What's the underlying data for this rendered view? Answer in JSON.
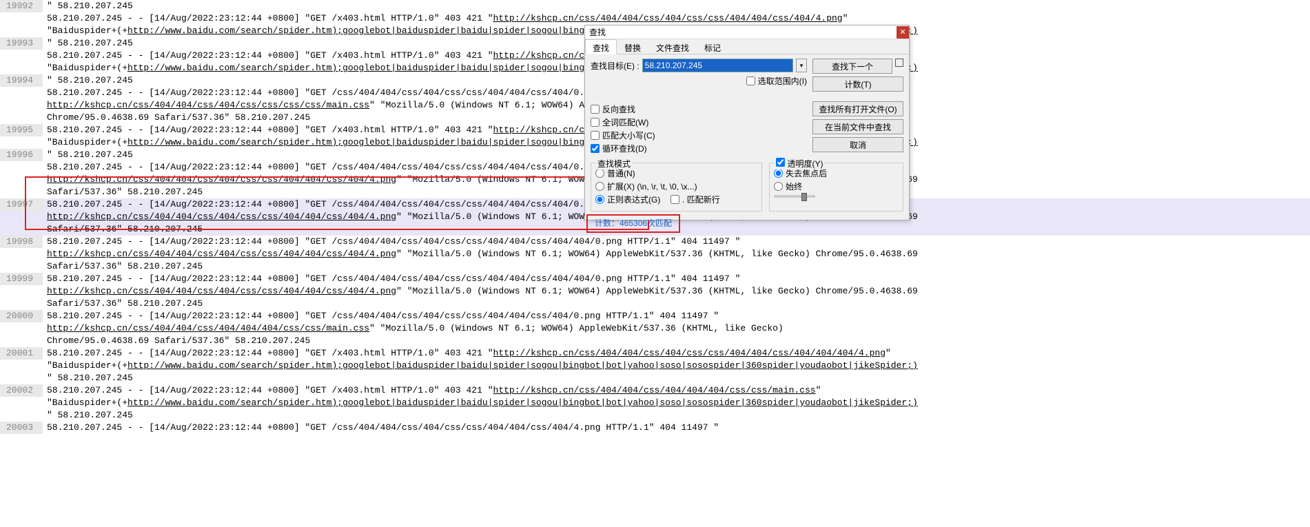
{
  "lines": [
    {
      "num": "19992",
      "hl": false,
      "segs": [
        {
          "t": "\" 58.210.207.245"
        }
      ]
    },
    {
      "num": "",
      "hl": false,
      "segs": [
        {
          "t": "58.210.207.245 - - [14/Aug/2022:23:12:44 +0800] \"GET /x403.html HTTP/1.0\" 403 421 \""
        },
        {
          "t": "http://kshcp.cn/css/404/404/css/404/css/css/404/404/css/404/4.png",
          "u": true
        },
        {
          "t": "\""
        }
      ]
    },
    {
      "num": "",
      "hl": false,
      "segs": [
        {
          "t": "\"Baiduspider+(+"
        },
        {
          "t": "http://www.baidu.com/search/spider.htm);googlebot|baiduspider|baidu|spider|sogou|bingbot|bot|yahoo|soso|sosospider|360spider|youdaobot|jikeSpider;)",
          "u": true
        }
      ]
    },
    {
      "num": "19993",
      "hl": false,
      "segs": [
        {
          "t": "\" 58.210.207.245"
        }
      ]
    },
    {
      "num": "",
      "hl": false,
      "segs": [
        {
          "t": "58.210.207.245 - - [14/Aug/2022:23:12:44 +0800] \"GET /x403.html HTTP/1.0\" 403 421 \""
        },
        {
          "t": "http://kshcp.cn/css/404/404/css/404/css/css/404/404/css/404/4.png",
          "u": true
        },
        {
          "t": "\""
        }
      ]
    },
    {
      "num": "",
      "hl": false,
      "segs": [
        {
          "t": "\"Baiduspider+(+"
        },
        {
          "t": "http://www.baidu.com/search/spider.htm);googlebot|baiduspider|baidu|spider|sogou|bingbot|bot|yahoo|soso|sosospider|360spider|youdaobot|jikeSpider;)",
          "u": true
        }
      ]
    },
    {
      "num": "19994",
      "hl": false,
      "segs": [
        {
          "t": "\" 58.210.207.245"
        }
      ]
    },
    {
      "num": "",
      "hl": false,
      "segs": [
        {
          "t": "58.210.207.245 - - [14/Aug/2022:23:12:44 +0800] \"GET /css/404/404/css/404/css/css/404/404/css/404/0.png HTTP/1.1\" 404 11497 \""
        }
      ]
    },
    {
      "num": "",
      "hl": false,
      "segs": [
        {
          "t": "http://kshcp.cn/css/404/404/css/404/css/css/css/css/main.css",
          "u": true
        },
        {
          "t": "\" \"Mozilla/5.0 (Windows NT 6.1; WOW64) AppleWebKit/537.36 (KHTML, like Gecko)"
        }
      ]
    },
    {
      "num": "",
      "hl": false,
      "segs": [
        {
          "t": "Chrome/95.0.4638.69 Safari/537.36\" 58.210.207.245"
        }
      ]
    },
    {
      "num": "19995",
      "hl": false,
      "segs": [
        {
          "t": "58.210.207.245 - - [14/Aug/2022:23:12:44 +0800] \"GET /x403.html HTTP/1.0\" 403 421 \""
        },
        {
          "t": "http://kshcp.cn/css/404/404/css/404/css/css/css/css/main.css",
          "u": true
        },
        {
          "t": "\""
        }
      ]
    },
    {
      "num": "",
      "hl": false,
      "segs": [
        {
          "t": "\"Baiduspider+(+"
        },
        {
          "t": "http://www.baidu.com/search/spider.htm);googlebot|baiduspider|baidu|spider|sogou|bingbot|bot|yahoo|soso|sosospider|360spider|youdaobot|jikeSpider;)",
          "u": true
        }
      ]
    },
    {
      "num": "19996",
      "hl": false,
      "segs": [
        {
          "t": "\" 58.210.207.245"
        }
      ]
    },
    {
      "num": "",
      "hl": false,
      "segs": [
        {
          "t": "58.210.207.245 - - [14/Aug/2022:23:12:44 +0800] \"GET /css/404/404/css/404/css/css/404/404/css/404/0.png HTTP/1.1\" 404 11497 \""
        }
      ]
    },
    {
      "num": "",
      "hl": false,
      "segs": [
        {
          "t": "http://kshcp.cn/css/404/404/css/404/css/css/404/404/css/404/4.png",
          "u": true
        },
        {
          "t": "\" \"Mozilla/5.0 (Windows NT 6.1; WOW64) AppleWebKit/537.36 (KHTML, like Gecko) Chrome/95.0.4638.69"
        }
      ]
    },
    {
      "num": "",
      "hl": false,
      "segs": [
        {
          "t": "Safari/537.36\" 58.210.207.245"
        }
      ]
    },
    {
      "num": "19997",
      "hl": true,
      "segs": [
        {
          "t": "58.210.207.245 - - [14/Aug/2022:23:12:44 +0800] \"GET /css/404/404/css/404/css/css/404/404/css/404/0.png HTTP/1.1\" 404 11497 \""
        }
      ]
    },
    {
      "num": "",
      "hl": true,
      "segs": [
        {
          "t": "http://kshcp.cn/css/404/404/css/404/css/css/404/404/css/404/4.png",
          "u": true
        },
        {
          "t": "\" \"Mozilla/5.0 (Windows NT 6.1; WOW64) AppleWebKit/537.36 (KHTML, like Gecko) Chrome/95.0.4638.69"
        }
      ]
    },
    {
      "num": "",
      "hl": true,
      "segs": [
        {
          "t": "Safari/537.36\" 58.210.207.245"
        }
      ]
    },
    {
      "num": "19998",
      "hl": false,
      "segs": [
        {
          "t": "58.210.207.245 - - [14/Aug/2022:23:12:44 +0800] \"GET /css/404/404/css/404/css/css/404/404/css/404/404/0.png HTTP/1.1\" 404 11497 \""
        }
      ]
    },
    {
      "num": "",
      "hl": false,
      "segs": [
        {
          "t": "http://kshcp.cn/css/404/404/css/404/css/css/404/404/css/404/4.png",
          "u": true
        },
        {
          "t": "\" \"Mozilla/5.0 (Windows NT 6.1; WOW64) AppleWebKit/537.36 (KHTML, like Gecko) Chrome/95.0.4638.69"
        }
      ]
    },
    {
      "num": "",
      "hl": false,
      "segs": [
        {
          "t": "Safari/537.36\" 58.210.207.245"
        }
      ]
    },
    {
      "num": "19999",
      "hl": false,
      "segs": [
        {
          "t": "58.210.207.245 - - [14/Aug/2022:23:12:44 +0800] \"GET /css/404/404/css/404/css/css/404/404/css/404/404/0.png HTTP/1.1\" 404 11497 \""
        }
      ]
    },
    {
      "num": "",
      "hl": false,
      "segs": [
        {
          "t": "http://kshcp.cn/css/404/404/css/404/css/css/404/404/css/404/4.png",
          "u": true
        },
        {
          "t": "\" \"Mozilla/5.0 (Windows NT 6.1; WOW64) AppleWebKit/537.36 (KHTML, like Gecko) Chrome/95.0.4638.69"
        }
      ]
    },
    {
      "num": "",
      "hl": false,
      "segs": [
        {
          "t": "Safari/537.36\" 58.210.207.245"
        }
      ]
    },
    {
      "num": "20000",
      "hl": false,
      "segs": [
        {
          "t": "58.210.207.245 - - [14/Aug/2022:23:12:44 +0800] \"GET /css/404/404/css/404/css/css/404/404/css/404/0.png HTTP/1.1\" 404 11497 \""
        }
      ]
    },
    {
      "num": "",
      "hl": false,
      "segs": [
        {
          "t": "http://kshcp.cn/css/404/404/css/404/404/404/css/css/main.css",
          "u": true
        },
        {
          "t": "\" \"Mozilla/5.0 (Windows NT 6.1; WOW64) AppleWebKit/537.36 (KHTML, like Gecko)"
        }
      ]
    },
    {
      "num": "",
      "hl": false,
      "segs": [
        {
          "t": "Chrome/95.0.4638.69 Safari/537.36\" 58.210.207.245"
        }
      ]
    },
    {
      "num": "20001",
      "hl": false,
      "segs": [
        {
          "t": "58.210.207.245 - - [14/Aug/2022:23:12:44 +0800] \"GET /x403.html HTTP/1.0\" 403 421 \""
        },
        {
          "t": "http://kshcp.cn/css/404/404/css/404/css/css/404/404/css/404/404/404/4.png",
          "u": true
        },
        {
          "t": "\""
        }
      ]
    },
    {
      "num": "",
      "hl": false,
      "segs": [
        {
          "t": "\"Baiduspider+(+"
        },
        {
          "t": "http://www.baidu.com/search/spider.htm);googlebot|baiduspider|baidu|spider|sogou|bingbot|bot|yahoo|soso|sosospider|360spider|youdaobot|jikeSpider;)",
          "u": true
        }
      ]
    },
    {
      "num": "",
      "hl": false,
      "segs": [
        {
          "t": "\" 58.210.207.245"
        }
      ]
    },
    {
      "num": "20002",
      "hl": false,
      "segs": [
        {
          "t": "58.210.207.245 - - [14/Aug/2022:23:12:44 +0800] \"GET /x403.html HTTP/1.0\" 403 421 \""
        },
        {
          "t": "http://kshcp.cn/css/404/404/css/404/404/404/css/css/main.css",
          "u": true
        },
        {
          "t": "\""
        }
      ]
    },
    {
      "num": "",
      "hl": false,
      "segs": [
        {
          "t": "\"Baiduspider+(+"
        },
        {
          "t": "http://www.baidu.com/search/spider.htm);googlebot|baiduspider|baidu|spider|sogou|bingbot|bot|yahoo|soso|sosospider|360spider|youdaobot|jikeSpider;)",
          "u": true
        }
      ]
    },
    {
      "num": "",
      "hl": false,
      "segs": [
        {
          "t": "\" 58.210.207.245"
        }
      ]
    },
    {
      "num": "20003",
      "hl": false,
      "segs": [
        {
          "t": "58.210.207.245 - - [14/Aug/2022:23:12:44 +0800] \"GET /css/404/404/css/404/css/css/404/404/css/404/4.png HTTP/1.1\" 404 11497 \""
        }
      ]
    }
  ],
  "dialog": {
    "title": "查找",
    "tabs": [
      "查找",
      "替换",
      "文件查找",
      "标记"
    ],
    "active_tab": 0,
    "target_label": "查找目标(E) :",
    "target_value": "58.210.207.245",
    "btn_find_next": "查找下一个",
    "btn_count": "计数(T)",
    "btn_find_all_open": "查找所有打开文件(O)",
    "btn_find_current": "在当前文件中查找",
    "btn_cancel": "取消",
    "chk_in_selection": "选取范围内(I)",
    "chk_backward": "反向查找",
    "chk_whole_word": "全词匹配(W)",
    "chk_match_case": "匹配大小写(C)",
    "chk_wrap": "循环查找(D)",
    "group_mode": "查找模式",
    "radio_normal": "普通(N)",
    "radio_extended": "扩展(X) (\\n, \\r, \\t, \\0, \\x...)",
    "radio_regex": "正则表达式(G)",
    "chk_dotall": ". 匹配新行",
    "chk_transparency": "透明度(Y)",
    "radio_onlostfocus": "失去焦点后",
    "radio_always": "始终",
    "status": "计数：465306次匹配"
  }
}
